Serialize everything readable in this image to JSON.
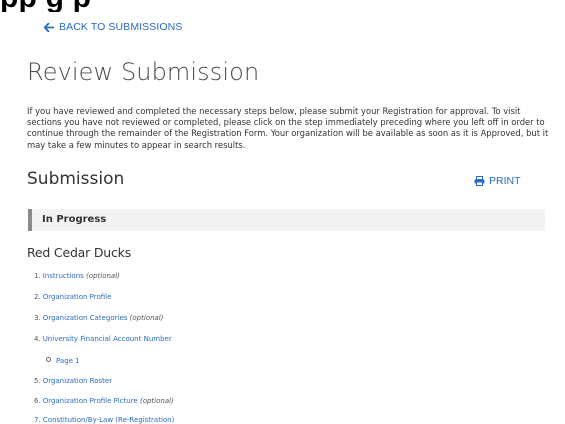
{
  "banner": {
    "text": "pp                                               g p"
  },
  "nav": {
    "back_label": "BACK TO SUBMISSIONS"
  },
  "page": {
    "title": "Review Submission",
    "intro": "If you have reviewed and completed the necessary steps below, please submit your Registration for approval. To visit sections you have not reviewed or completed, please click on the step immediately preceding where you left off in order to continue through the remainder of the Registration Form. Your organization will be available as soon as it is Approved, but it may take a few minutes to appear in search results."
  },
  "submission": {
    "title": "Submission",
    "print_label": "PRINT",
    "status": "In Progress",
    "organization": "Red Cedar Ducks"
  },
  "steps": [
    {
      "num": "1.",
      "label": "Instructions",
      "optional": "(optional)"
    },
    {
      "num": "2.",
      "label": "Organization Profile",
      "optional": ""
    },
    {
      "num": "3.",
      "label": "Organization Categories",
      "optional": "(optional)"
    },
    {
      "num": "4.",
      "label": "University Financial Account Number",
      "optional": ""
    },
    {
      "num": "5.",
      "label": "Organization Roster",
      "optional": ""
    },
    {
      "num": "6.",
      "label": "Organization Profile Picture",
      "optional": "(optional)"
    }
  ],
  "substeps": [
    {
      "label": "Page 1"
    }
  ],
  "cut_step": {
    "text": "7. Constitution/By-Law (Re-Registration)"
  },
  "colors": {
    "link": "#2a6bbf",
    "text": "#333333",
    "status_bg": "#f3f3f3",
    "status_border": "#8a8a8a"
  },
  "icons": {
    "back": "arrow-left-icon",
    "print": "printer-icon"
  }
}
